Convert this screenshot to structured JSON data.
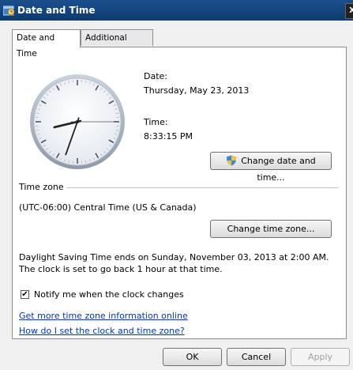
{
  "window": {
    "title": "Date and Time",
    "close_label": "X"
  },
  "tabs": [
    {
      "label": "Date and Time",
      "active": true
    },
    {
      "label": "Additional Clocks",
      "active": false
    }
  ],
  "date": {
    "label": "Date:",
    "value": "Thursday, May 23, 2013"
  },
  "time": {
    "label": "Time:",
    "value": "8:33:15 PM"
  },
  "clock": {
    "hour": 8,
    "minute": 33,
    "second": 15
  },
  "change_datetime_button": {
    "label": "Change date and time...",
    "icon": "uac-shield-icon"
  },
  "timezone": {
    "section_label": "Time zone",
    "value": "(UTC-06:00) Central Time (US & Canada)",
    "change_button": "Change time zone..."
  },
  "dst_message": "Daylight Saving Time ends on Sunday, November 03, 2013 at 2:00 AM. The clock is set to go back 1 hour at that time.",
  "notify": {
    "label": "Notify me when the clock changes",
    "checked": true
  },
  "links": {
    "more_info": "Get more time zone information online",
    "how_to": "How do I set the clock and time zone?"
  },
  "buttons": {
    "ok": "OK",
    "cancel": "Cancel",
    "apply": "Apply"
  },
  "colors": {
    "title_bar": "#0d3a6e",
    "link": "#0033cc"
  }
}
